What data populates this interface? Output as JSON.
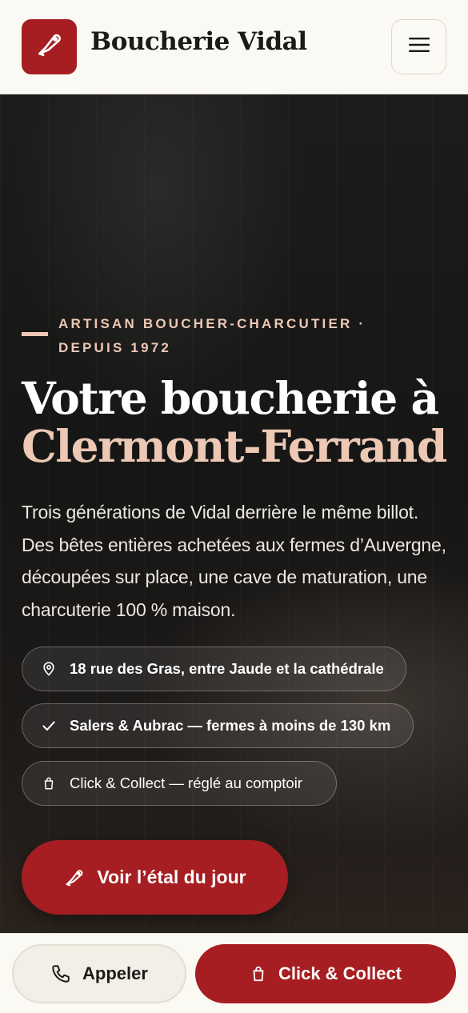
{
  "header": {
    "brand": "Boucherie Vidal",
    "logo_icon": "cleaver-tag-icon",
    "menu_icon": "hamburger-menu-icon"
  },
  "hero": {
    "eyebrow": "Artisan boucher-charcutier · depuis 1972",
    "title_line1": "Votre boucherie à",
    "title_line2": "Clermont-Ferrand",
    "lead": "Trois générations de Vidal derrière le même billot. Des bêtes entières achetées aux fermes d’Auvergne, découpées sur place, une cave de maturation, une charcuterie 100 % maison.",
    "features": [
      {
        "icon": "map-pin-icon",
        "label": "18 rue des Gras, entre Jaude et la cathédrale"
      },
      {
        "icon": "check-icon",
        "label": "Salers & Aubrac — fermes à moins de 130 km"
      },
      {
        "icon": "shopping-bag-icon",
        "label": "Click & Collect — réglé au comptoir"
      }
    ],
    "cta_label": "Voir l’étal du jour"
  },
  "bottom_bar": {
    "call_label": "Appeler",
    "collect_label": "Click & Collect"
  },
  "colors": {
    "brand_red": "#a61e22",
    "accent_pink": "#edc8b4",
    "header_bg": "#fbf9f4"
  }
}
